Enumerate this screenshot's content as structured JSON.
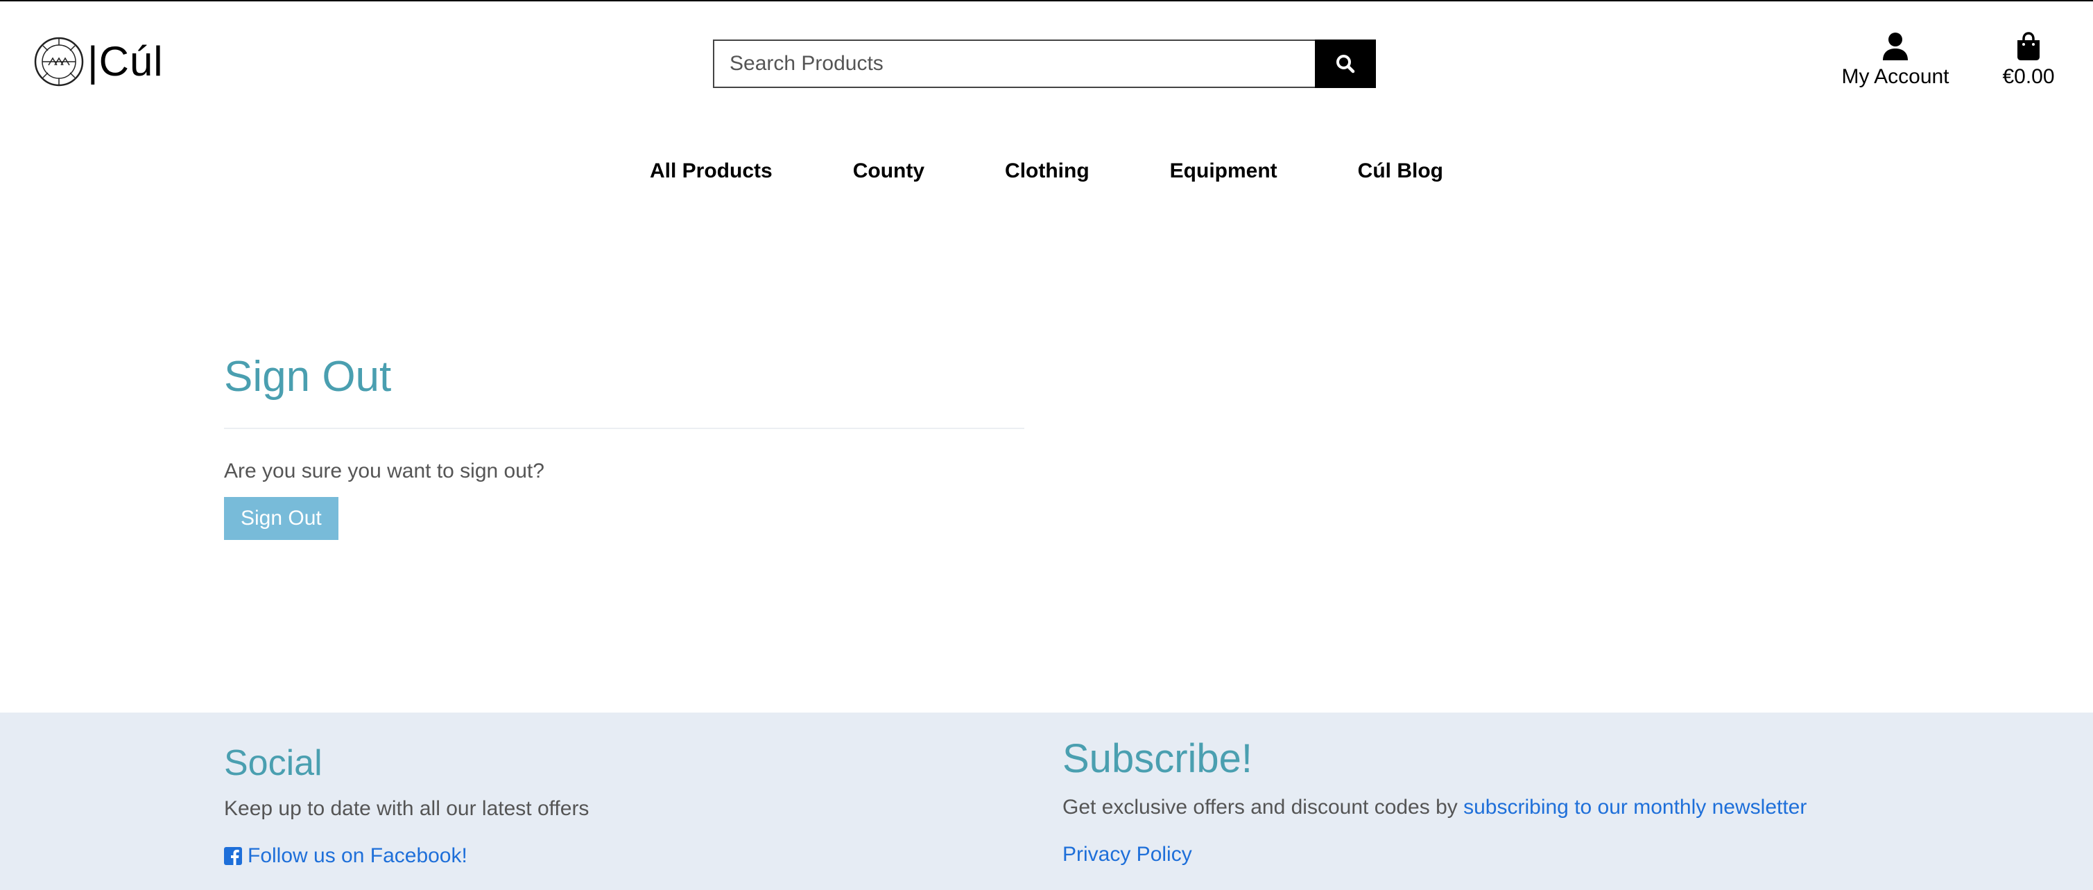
{
  "header": {
    "logo_text": "|Cúl",
    "search_placeholder": "Search Products",
    "account_label": "My Account",
    "cart_total": "€0.00"
  },
  "nav": {
    "items": [
      {
        "label": "All Products"
      },
      {
        "label": "County"
      },
      {
        "label": "Clothing"
      },
      {
        "label": "Equipment"
      },
      {
        "label": "Cúl Blog"
      }
    ]
  },
  "main": {
    "title": "Sign Out",
    "prompt": "Are you sure you want to sign out?",
    "button_label": "Sign Out"
  },
  "footer": {
    "social": {
      "title": "Social",
      "text": "Keep up to date with all our latest offers",
      "facebook_link": "Follow us on Facebook!"
    },
    "subscribe": {
      "title": "Subscribe!",
      "text": "Get exclusive offers and discount codes by ",
      "newsletter_link": "subscribing to our monthly newsletter",
      "privacy_link": "Privacy Policy"
    }
  },
  "colors": {
    "accent_heading": "#4a9fb0",
    "button": "#78bbd9",
    "footer_bg": "#e6ecf4",
    "link": "#1e6fd9"
  },
  "icons": {
    "logo": "gaa-football-icon",
    "search": "search-icon",
    "account": "user-icon",
    "cart": "shopping-bag-icon",
    "facebook": "facebook-icon"
  }
}
